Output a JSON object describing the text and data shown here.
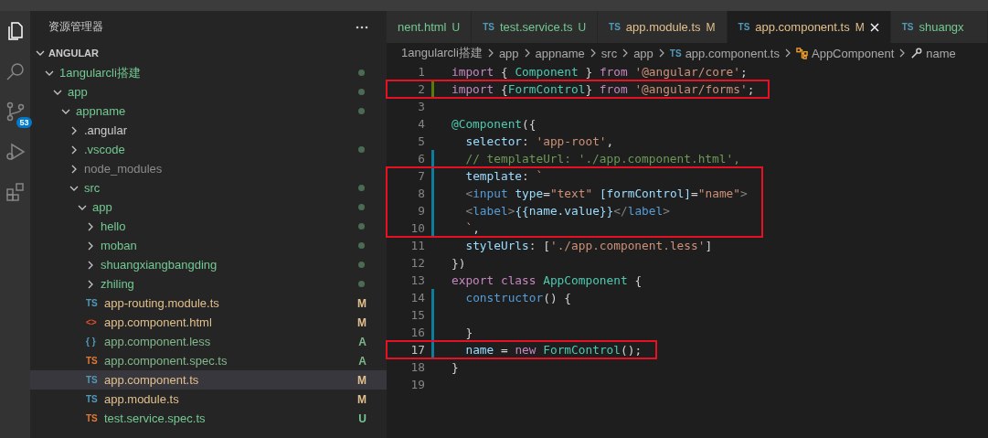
{
  "activity_bar": {
    "items": [
      {
        "kind": "files",
        "selected": true
      },
      {
        "kind": "search",
        "selected": false
      },
      {
        "kind": "source-control",
        "selected": false,
        "badge": "53"
      },
      {
        "kind": "run",
        "selected": false
      },
      {
        "kind": "extensions",
        "selected": false
      }
    ]
  },
  "sidebar": {
    "title": "资源管理器",
    "section": {
      "label": "ANGULAR",
      "expanded": true
    },
    "tree": [
      {
        "label": "1angularcli搭建",
        "kind": "folder",
        "color": "#73c991",
        "expanded": true,
        "dot": true,
        "selected": false,
        "children": [
          {
            "label": "app",
            "kind": "folder",
            "color": "#73c991",
            "expanded": true,
            "dot": true,
            "selected": false,
            "children": [
              {
                "label": "appname",
                "kind": "folder",
                "color": "#73c991",
                "expanded": true,
                "dot": true,
                "selected": false,
                "children": [
                  {
                    "label": ".angular",
                    "kind": "folder",
                    "color": "#cccccc",
                    "expanded": false,
                    "dot": false,
                    "selected": false
                  },
                  {
                    "label": ".vscode",
                    "kind": "folder",
                    "color": "#73c991",
                    "expanded": false,
                    "dot": true,
                    "selected": false
                  },
                  {
                    "label": "node_modules",
                    "kind": "folder",
                    "color": "#8c8c8c",
                    "expanded": false,
                    "dot": false,
                    "selected": false
                  },
                  {
                    "label": "src",
                    "kind": "folder",
                    "color": "#73c991",
                    "expanded": true,
                    "dot": true,
                    "selected": false,
                    "children": [
                      {
                        "label": "app",
                        "kind": "folder",
                        "color": "#73c991",
                        "expanded": true,
                        "dot": true,
                        "selected": false,
                        "children": [
                          {
                            "label": "hello",
                            "kind": "folder",
                            "color": "#73c991",
                            "expanded": false,
                            "dot": true,
                            "selected": false
                          },
                          {
                            "label": "moban",
                            "kind": "folder",
                            "color": "#73c991",
                            "expanded": false,
                            "dot": true,
                            "selected": false
                          },
                          {
                            "label": "shuangxiangbangding",
                            "kind": "folder",
                            "color": "#73c991",
                            "expanded": false,
                            "dot": true,
                            "selected": false
                          },
                          {
                            "label": "zhiling",
                            "kind": "folder",
                            "color": "#73c991",
                            "expanded": false,
                            "dot": true,
                            "selected": false
                          },
                          {
                            "label": "app-routing.module.ts",
                            "kind": "ts",
                            "icon": "TS",
                            "color": "#e2c08d",
                            "decoration": "M",
                            "selected": false
                          },
                          {
                            "label": "app.component.html",
                            "kind": "html",
                            "icon": "<>",
                            "color": "#e2c08d",
                            "decoration": "M",
                            "selected": false
                          },
                          {
                            "label": "app.component.less",
                            "kind": "less",
                            "icon": "{ }",
                            "color": "#81b88b",
                            "decoration": "A",
                            "selected": false
                          },
                          {
                            "label": "app.component.spec.ts",
                            "kind": "spec",
                            "icon": "TS",
                            "color": "#81b88b",
                            "decoration": "A",
                            "selected": false
                          },
                          {
                            "label": "app.component.ts",
                            "kind": "ts",
                            "icon": "TS",
                            "color": "#e2c08d",
                            "decoration": "M",
                            "selected": true
                          },
                          {
                            "label": "app.module.ts",
                            "kind": "ts",
                            "icon": "TS",
                            "color": "#e2c08d",
                            "decoration": "M",
                            "selected": false
                          },
                          {
                            "label": "test.service.spec.ts",
                            "kind": "spec",
                            "icon": "TS",
                            "color": "#73c991",
                            "decoration": "U",
                            "selected": false
                          }
                        ]
                      }
                    ]
                  }
                ]
              }
            ]
          }
        ]
      }
    ]
  },
  "tabs": [
    {
      "label": "nent.html",
      "color": "#73c991",
      "decoration": "U",
      "selected": false
    },
    {
      "label": "test.service.ts",
      "icon": "TS",
      "color": "#73c991",
      "decoration": "U",
      "selected": false
    },
    {
      "label": "app.module.ts",
      "icon": "TS",
      "color": "#e2c08d",
      "decoration": "M",
      "selected": false
    },
    {
      "label": "app.component.ts",
      "icon": "TS",
      "color": "#e2c08d",
      "decoration": "M",
      "selected": true
    },
    {
      "label": "shuangx",
      "icon": "TS",
      "color": "#73c991",
      "selected": false
    }
  ],
  "breadcrumb": [
    {
      "label": "1angularcli搭建",
      "kind": "folder"
    },
    {
      "label": "app",
      "kind": "folder"
    },
    {
      "label": "appname",
      "kind": "folder"
    },
    {
      "label": "src",
      "kind": "folder"
    },
    {
      "label": "app",
      "kind": "folder"
    },
    {
      "label": "app.component.ts",
      "kind": "file",
      "icon": "TS"
    },
    {
      "label": "AppComponent",
      "kind": "class"
    },
    {
      "label": "name",
      "kind": "property"
    }
  ],
  "code": [
    {
      "number": "1",
      "added": false,
      "modified": false,
      "boxed": false,
      "current": false,
      "text": "import { Component } from '@angular/core';"
    },
    {
      "number": "2",
      "added": true,
      "modified": false,
      "boxed": true,
      "current": false,
      "text": "import {FormControl} from '@angular/forms';"
    },
    {
      "number": "3",
      "added": false,
      "modified": false,
      "boxed": false,
      "current": false
    },
    {
      "number": "4",
      "added": false,
      "modified": false,
      "boxed": false,
      "current": false,
      "text": "@Component({"
    },
    {
      "number": "5",
      "added": false,
      "modified": false,
      "boxed": false,
      "current": false,
      "text": "  selector: 'app-root',"
    },
    {
      "number": "6",
      "added": false,
      "modified": true,
      "boxed": false,
      "current": false,
      "text": "  // templateUrl: './app.component.html',"
    },
    {
      "number": "7",
      "added": false,
      "modified": true,
      "boxed": true,
      "current": false,
      "text": "  template: `"
    },
    {
      "number": "8",
      "added": false,
      "modified": true,
      "boxed": true,
      "current": false,
      "text": "  <input type=\"text\" [formControl]=\"name\">"
    },
    {
      "number": "9",
      "added": false,
      "modified": true,
      "boxed": true,
      "current": false,
      "text": "  <label>{{name.value}}</label>"
    },
    {
      "number": "10",
      "added": false,
      "modified": true,
      "boxed": true,
      "current": false,
      "text": "  `,"
    },
    {
      "number": "11",
      "added": false,
      "modified": false,
      "boxed": false,
      "current": false,
      "text": "  styleUrls: ['./app.component.less']"
    },
    {
      "number": "12",
      "added": false,
      "modified": false,
      "boxed": false,
      "current": false,
      "text": "})"
    },
    {
      "number": "13",
      "added": false,
      "modified": false,
      "boxed": false,
      "current": false,
      "text": "export class AppComponent {"
    },
    {
      "number": "14",
      "added": false,
      "modified": true,
      "boxed": false,
      "current": false,
      "text": "  constructor() {"
    },
    {
      "number": "15",
      "added": false,
      "modified": true,
      "boxed": false,
      "current": false
    },
    {
      "number": "16",
      "added": false,
      "modified": true,
      "boxed": false,
      "current": false,
      "text": "  }"
    },
    {
      "number": "17",
      "added": false,
      "modified": true,
      "boxed": true,
      "current": true,
      "text": "  name = new FormControl();"
    },
    {
      "number": "18",
      "added": false,
      "modified": false,
      "boxed": false,
      "current": false,
      "text": "}"
    },
    {
      "number": "19",
      "added": false,
      "modified": false,
      "boxed": false,
      "current": false
    }
  ]
}
